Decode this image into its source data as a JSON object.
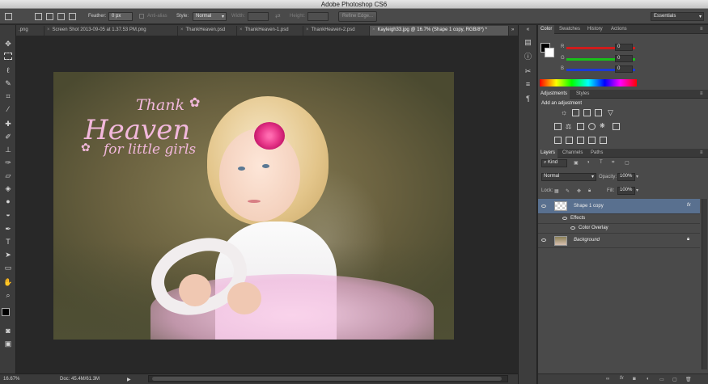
{
  "app": {
    "title": "Adobe Photoshop CS6"
  },
  "options_bar": {
    "feather_label": "Feather:",
    "feather_value": "0 px",
    "antialias_label": "Anti-alias",
    "style_label": "Style:",
    "style_value": "Normal",
    "width_label": "Width:",
    "height_label": "Height:",
    "refine_edge_label": "Refine Edge...",
    "workspace_value": "Essentials"
  },
  "tabs": [
    {
      "label": ".png"
    },
    {
      "label": "Screen Shot 2013-09-05 at 1.37.53 PM.png"
    },
    {
      "label": "ThankHeaven.psd"
    },
    {
      "label": "ThankHeaven-1.psd"
    },
    {
      "label": "ThankHeaven-2.psd"
    },
    {
      "label": "Kayleigh33.jpg @ 16.7% (Shape 1 copy, RGB/8*) *"
    }
  ],
  "tabs_overflow": "»",
  "artwork": {
    "line1": "Thank",
    "line2": "Heaven",
    "line3": "for little girls"
  },
  "status": {
    "zoom": "16.67%",
    "doc": "Doc: 45.4M/61.3M"
  },
  "color_panel": {
    "tabs": [
      "Color",
      "Swatches",
      "History",
      "Actions"
    ],
    "channels": [
      {
        "label": "R",
        "value": "0",
        "color": "#d01c1c"
      },
      {
        "label": "G",
        "value": "0",
        "color": "#18c018"
      },
      {
        "label": "B",
        "value": "0",
        "color": "#1c38d8"
      }
    ]
  },
  "adjustments_panel": {
    "tabs": [
      "Adjustments",
      "Styles"
    ],
    "heading": "Add an adjustment"
  },
  "layers_panel": {
    "tabs": [
      "Layers",
      "Channels",
      "Paths"
    ],
    "kind_label": "Kind",
    "blend_mode": "Normal",
    "opacity_label": "Opacity:",
    "opacity_value": "100%",
    "lock_label": "Lock:",
    "fill_label": "Fill:",
    "fill_value": "100%",
    "layers": [
      {
        "name": "Shape 1 copy",
        "fx": "fx",
        "selected": true
      },
      {
        "name": "Effects"
      },
      {
        "name": "Color Overlay"
      },
      {
        "name": "Background"
      }
    ],
    "footer_fx": "fx"
  },
  "colors": {
    "accent_selected_layer": "#59708f",
    "artwork_text": "#f2b8dc",
    "flower": "#e8388a"
  }
}
